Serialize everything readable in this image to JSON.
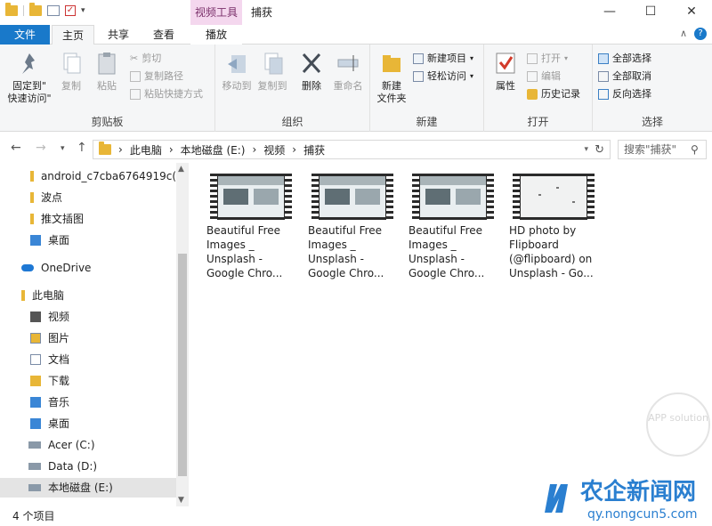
{
  "window": {
    "context_tab": "视频工具",
    "title": "捕获",
    "controls": {
      "minimize": "—",
      "maximize": "☐",
      "close": "✕"
    }
  },
  "tabs": {
    "file": "文件",
    "home": "主页",
    "share": "共享",
    "view": "查看",
    "play": "播放"
  },
  "ribbon": {
    "clipboard": {
      "label": "剪贴板",
      "pin_line1": "固定到\"",
      "pin_line2": "快速访问\"",
      "copy": "复制",
      "paste": "粘贴",
      "cut": "剪切",
      "copy_path": "复制路径",
      "paste_shortcut": "粘贴快捷方式"
    },
    "organize": {
      "label": "组织",
      "move_to": "移动到",
      "copy_to": "复制到",
      "delete": "删除",
      "rename": "重命名"
    },
    "new": {
      "label": "新建",
      "new_folder_line1": "新建",
      "new_folder_line2": "文件夹",
      "new_item": "新建项目",
      "easy_access": "轻松访问"
    },
    "open": {
      "label": "打开",
      "properties": "属性",
      "open": "打开",
      "edit": "编辑",
      "history": "历史记录"
    },
    "select": {
      "label": "选择",
      "select_all": "全部选择",
      "select_none": "全部取消",
      "invert": "反向选择"
    }
  },
  "address": {
    "back": "←",
    "forward": "→",
    "up": "↑",
    "crumbs": [
      "此电脑",
      "本地磁盘 (E:)",
      "视频",
      "捕获"
    ],
    "separator": "›",
    "search_placeholder": "搜索\"捕获\""
  },
  "nav": {
    "items": [
      {
        "label": "android_c7cba6764919c("
      },
      {
        "label": "波点"
      },
      {
        "label": "推文插图"
      },
      {
        "label": "桌面"
      },
      {
        "label": "OneDrive"
      },
      {
        "label": "此电脑"
      },
      {
        "label": "视频"
      },
      {
        "label": "图片"
      },
      {
        "label": "文档"
      },
      {
        "label": "下载"
      },
      {
        "label": "音乐"
      },
      {
        "label": "桌面"
      },
      {
        "label": "Acer (C:)"
      },
      {
        "label": "Data (D:)"
      },
      {
        "label": "本地磁盘 (E:)"
      }
    ]
  },
  "files": [
    {
      "line1": "Beautiful Free",
      "line2": "Images _",
      "line3": "Unsplash -",
      "line4": "Google Chro..."
    },
    {
      "line1": "Beautiful Free",
      "line2": "Images _",
      "line3": "Unsplash -",
      "line4": "Google Chro..."
    },
    {
      "line1": "Beautiful Free",
      "line2": "Images _",
      "line3": "Unsplash -",
      "line4": "Google Chro..."
    },
    {
      "line1": "HD photo by",
      "line2": "Flipboard",
      "line3": "(@flipboard) on",
      "line4": "Unsplash - Go..."
    }
  ],
  "status": {
    "count": "4 个项目"
  },
  "watermark": {
    "text": "农企新闻网",
    "url": "qy.nongcun5.com",
    "badge": "APP solution"
  },
  "colors": {
    "file_tab": "#1979ca",
    "context_tab": "#f4d7ee",
    "folder": "#e8b637",
    "onedrive": "#1e78d4"
  }
}
